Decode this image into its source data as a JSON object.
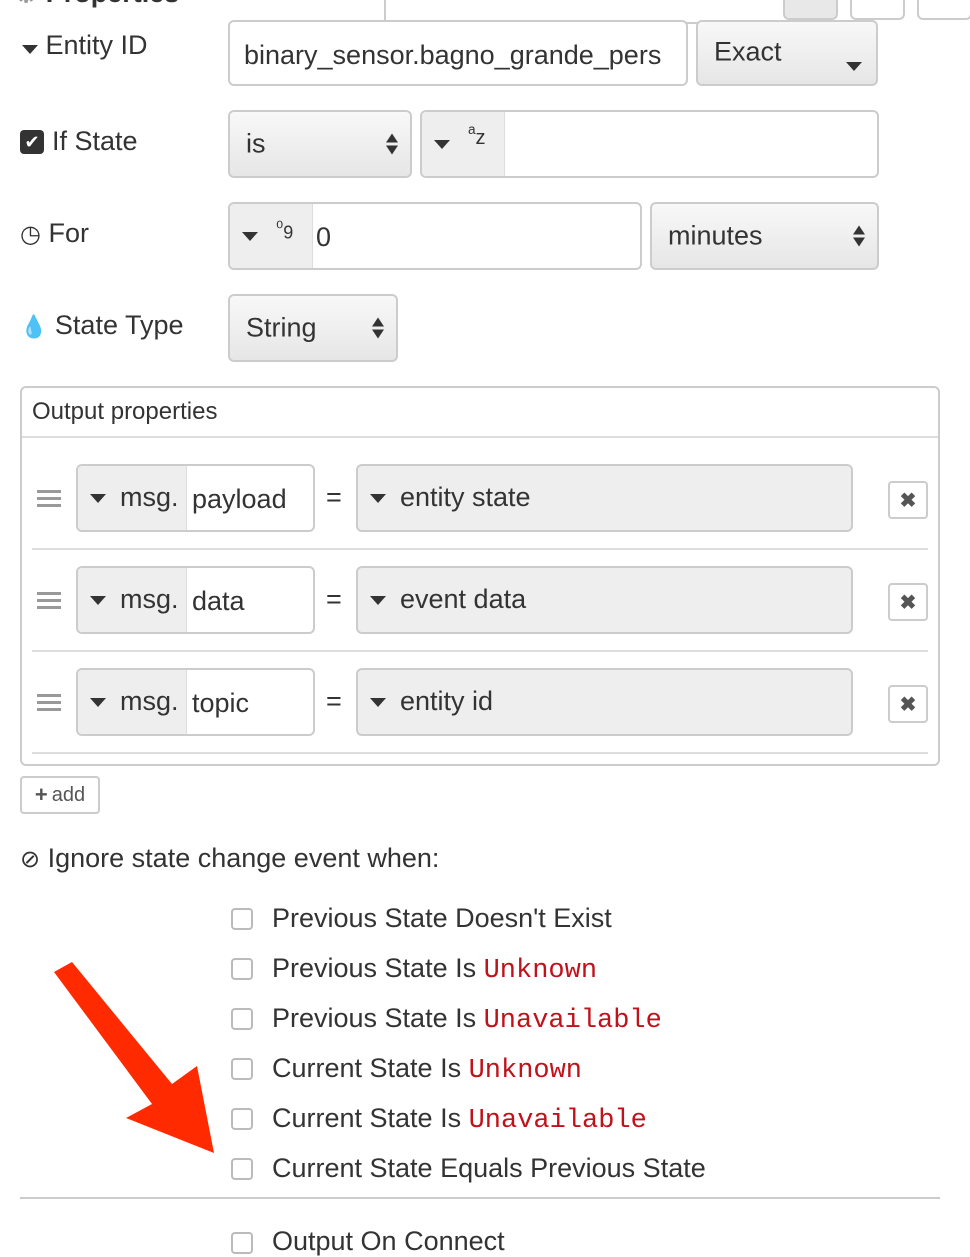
{
  "header": {
    "title": "Properties"
  },
  "entity_id": {
    "label": "Entity ID",
    "value": "binary_sensor.bagno_grande_pers",
    "match": "Exact"
  },
  "if_state": {
    "label": "If State",
    "checked": true,
    "operator": "is",
    "type_hint": "az",
    "value": ""
  },
  "for": {
    "label": "For",
    "type_hint": "09",
    "value": "0",
    "unit": "minutes"
  },
  "state_type": {
    "label": "State Type",
    "value": "String"
  },
  "output": {
    "title": "Output properties",
    "rows": [
      {
        "prefix": "msg.",
        "property": "payload",
        "equals": "=",
        "value": "entity state"
      },
      {
        "prefix": "msg.",
        "property": "data",
        "equals": "=",
        "value": "event data"
      },
      {
        "prefix": "msg.",
        "property": "topic",
        "equals": "=",
        "value": "entity id"
      }
    ],
    "add_label": "add"
  },
  "ignore": {
    "title": "Ignore state change event when:",
    "options": [
      {
        "text": "Previous State Doesn't Exist",
        "code": ""
      },
      {
        "text": "Previous State Is ",
        "code": "Unknown"
      },
      {
        "text": "Previous State Is ",
        "code": "Unavailable"
      },
      {
        "text": "Current State Is ",
        "code": "Unknown"
      },
      {
        "text": "Current State Is ",
        "code": "Unavailable"
      },
      {
        "text": "Current State Equals Previous State",
        "code": ""
      }
    ]
  },
  "output_on_connect": {
    "label": "Output On Connect"
  },
  "colors": {
    "arrow": "#ff2a00",
    "code": "#c0121b",
    "border": "#cccccc"
  }
}
